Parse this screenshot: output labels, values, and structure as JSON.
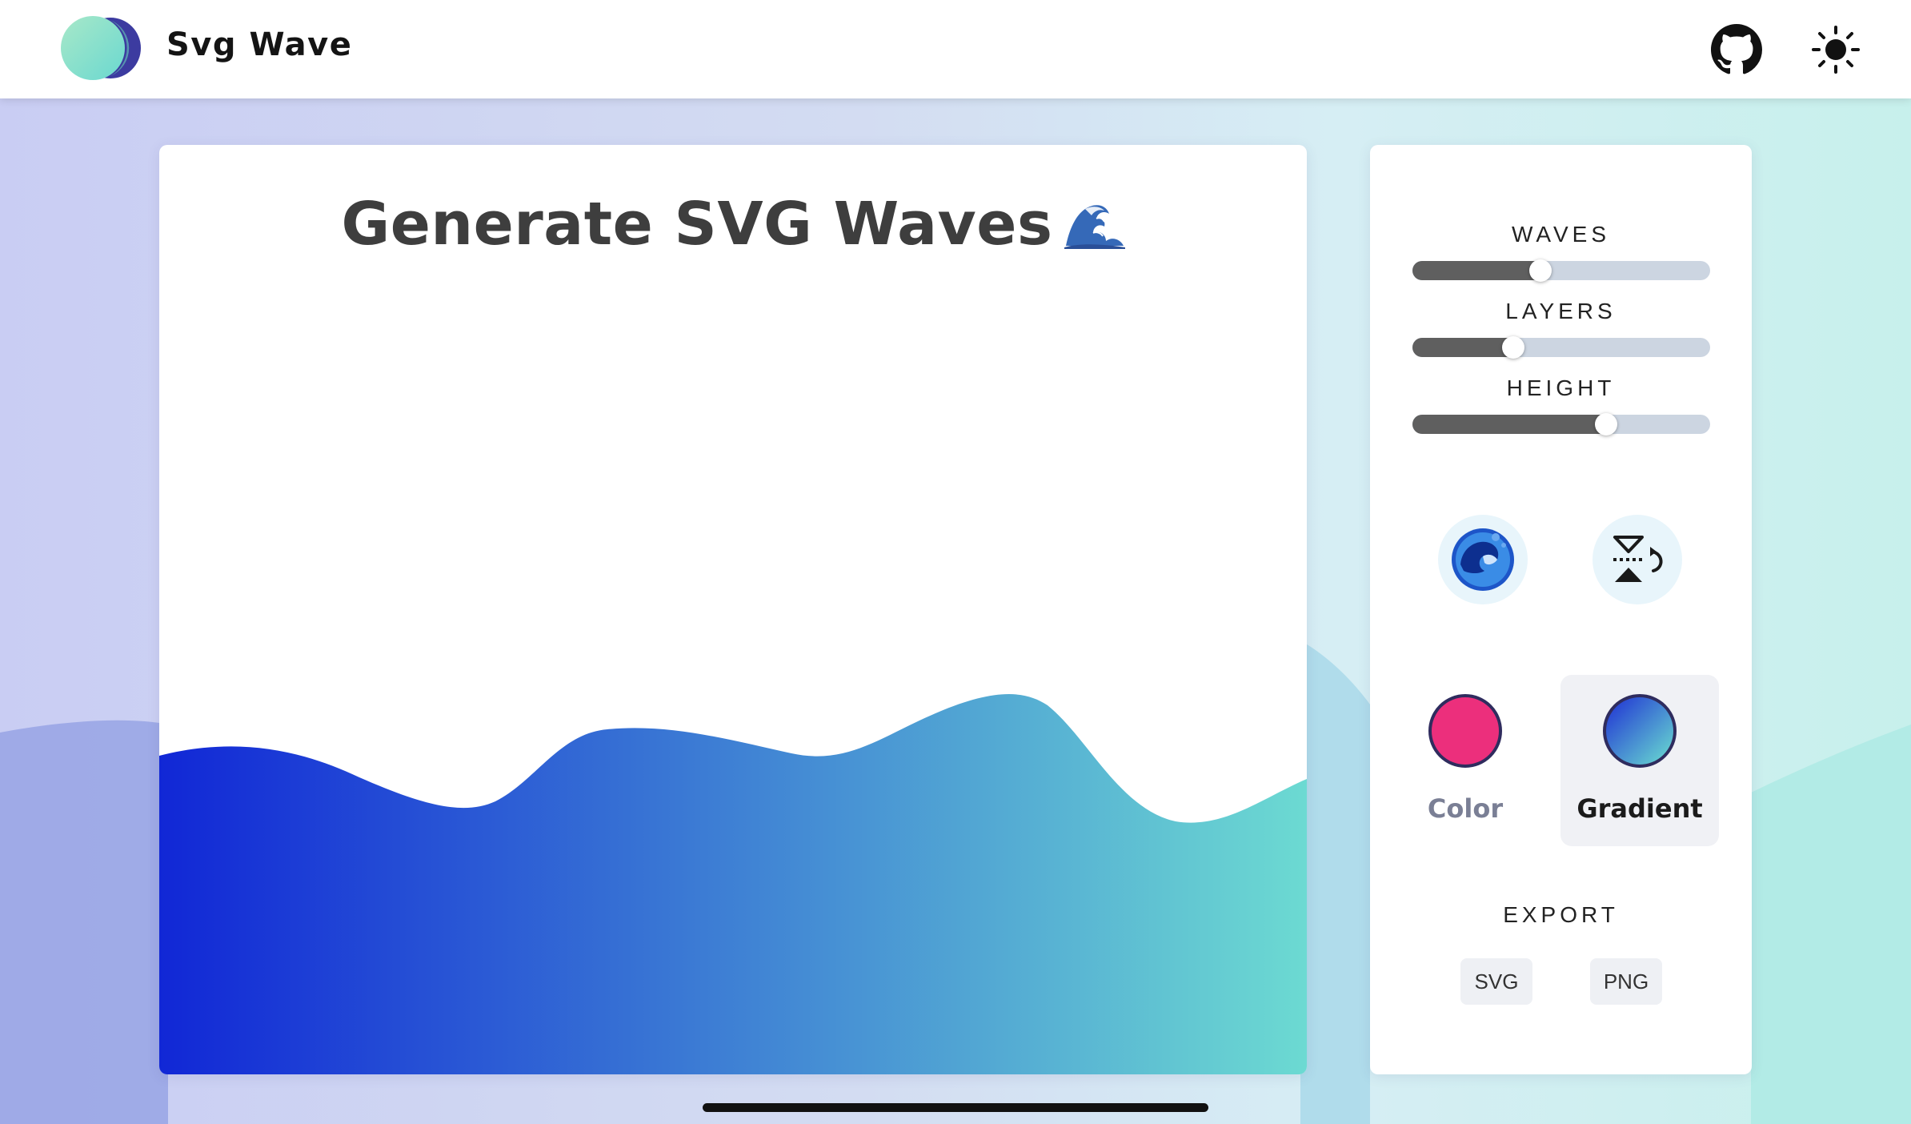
{
  "app": {
    "brand": "Svg Wave"
  },
  "header": {
    "github_icon": "github-icon",
    "theme_icon": "sun-icon"
  },
  "preview": {
    "title": "Generate SVG Waves",
    "title_emoji_icon": "great-wave-emoji-icon",
    "gradient_colors": [
      "#1127d6",
      "#6cdad2"
    ]
  },
  "controls": {
    "waves": {
      "label": "WAVES",
      "value_fraction": 0.43
    },
    "layers": {
      "label": "LAYERS",
      "value_fraction": 0.34
    },
    "height": {
      "label": "HEIGHT",
      "value_fraction": 0.65
    },
    "randomize_icon": "wave-randomize-icon",
    "flip_icon": "flip-vertical-icon"
  },
  "modes": {
    "color": {
      "label": "Color",
      "swatch": "#ec2f7c",
      "label_color": "#7a7f95"
    },
    "gradient": {
      "label": "Gradient",
      "swatch_from": "#1f2fd4",
      "swatch_to": "#6be0d0",
      "label_color": "#1b1b1b",
      "selected": true
    }
  },
  "export": {
    "label": "EXPORT",
    "svg": "SVG",
    "png": "PNG"
  }
}
